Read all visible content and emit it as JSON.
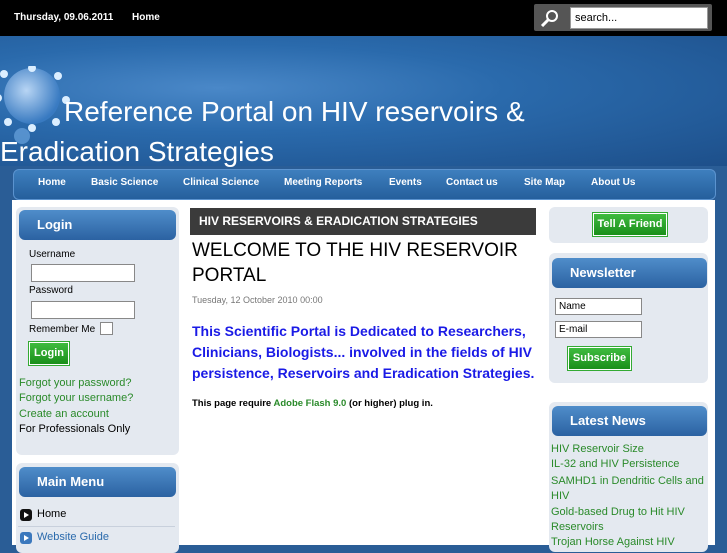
{
  "topbar": {
    "date": "Thursday, 09.06.2011",
    "home": "Home",
    "search_placeholder": "search..."
  },
  "banner": {
    "title": "Reference Portal on HIV reservoirs & Eradication Strategies"
  },
  "nav": [
    "Home",
    "Basic Science",
    "Clinical Science",
    "Meeting Reports",
    "Events",
    "Contact us",
    "Site Map",
    "About Us"
  ],
  "login": {
    "title": "Login",
    "username_label": "Username",
    "password_label": "Password",
    "remember_label": "Remember Me",
    "button": "Login",
    "links": [
      "Forgot your password?",
      "Forgot your username?",
      "Create an account"
    ],
    "professionals": "For Professionals Only"
  },
  "main_menu": {
    "title": "Main Menu",
    "items": [
      "Home",
      "Website Guide"
    ]
  },
  "article": {
    "section": "HIV RESERVOIRS & ERADICATION STRATEGIES",
    "title": "WELCOME TO THE HIV RESERVOIR PORTAL",
    "date": "Tuesday, 12 October 2010 00:00",
    "intro": "This Scientific Portal is Dedicated to Researchers, Clinicians, Biologists... involved in the fields of HIV persistence, Reservoirs and Eradication Strategies.",
    "flash_before": "This page require ",
    "flash_link": "Adobe Flash 9.0",
    "flash_after": " (or higher) plug in."
  },
  "right": {
    "tell_friend": "Tell A Friend",
    "newsletter": {
      "title": "Newsletter",
      "name_placeholder": "Name",
      "email_placeholder": "E-mail",
      "button": "Subscribe"
    },
    "latest_news": {
      "title": "Latest News",
      "items": [
        "HIV Reservoir Size",
        "IL-32 and HIV Persistence",
        "SAMHD1 in Dendritic Cells and HIV",
        "Gold-based Drug to Hit HIV Reservoirs",
        "Trojan Horse Against HIV"
      ]
    }
  },
  "colors": {
    "link_green": "#2a8a2a",
    "intro_blue": "#1a1ae6",
    "header_blue": "#2b62a2"
  }
}
